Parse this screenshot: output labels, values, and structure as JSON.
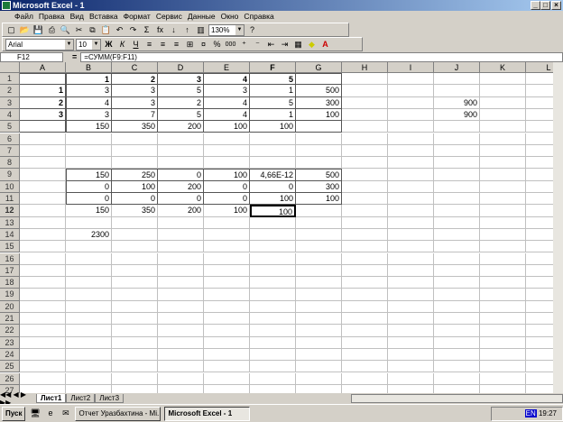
{
  "window": {
    "title": "Microsoft Excel - 1"
  },
  "menu": [
    "Файл",
    "Правка",
    "Вид",
    "Вставка",
    "Формат",
    "Сервис",
    "Данные",
    "Окно",
    "Справка"
  ],
  "toolbar": {
    "zoom": "130%",
    "font": "Arial",
    "size": "10",
    "bold": "Ж",
    "italic": "К",
    "underline": "Ч",
    "sum": "Σ",
    "fx": "fx",
    "percent": "%",
    "thousands": "000"
  },
  "formula_bar": {
    "cell": "F12",
    "eq": "=",
    "formula": "=СУММ(F9:F11)"
  },
  "columns": [
    "A",
    "B",
    "C",
    "D",
    "E",
    "F",
    "G",
    "H",
    "I",
    "J",
    "K",
    "L"
  ],
  "rows": [
    [
      "",
      "1",
      "2",
      "3",
      "4",
      "5",
      "",
      "",
      "",
      "",
      "",
      ""
    ],
    [
      "1",
      "3",
      "3",
      "5",
      "3",
      "1",
      "500",
      "",
      "",
      "",
      "",
      ""
    ],
    [
      "2",
      "4",
      "3",
      "2",
      "4",
      "5",
      "300",
      "",
      "",
      "900",
      "",
      ""
    ],
    [
      "3",
      "3",
      "7",
      "5",
      "4",
      "1",
      "100",
      "",
      "",
      "900",
      "",
      ""
    ],
    [
      "",
      "150",
      "350",
      "200",
      "100",
      "100",
      "",
      "",
      "",
      "",
      "",
      ""
    ],
    [
      "",
      "",
      "",
      "",
      "",
      "",
      "",
      "",
      "",
      "",
      "",
      ""
    ],
    [
      "",
      "",
      "",
      "",
      "",
      "",
      "",
      "",
      "",
      "",
      "",
      ""
    ],
    [
      "",
      "",
      "",
      "",
      "",
      "",
      "",
      "",
      "",
      "",
      "",
      ""
    ],
    [
      "",
      "150",
      "250",
      "0",
      "100",
      "4,66E-12",
      "500",
      "",
      "",
      "",
      "",
      ""
    ],
    [
      "",
      "0",
      "100",
      "200",
      "0",
      "0",
      "300",
      "",
      "",
      "",
      "",
      ""
    ],
    [
      "",
      "0",
      "0",
      "0",
      "0",
      "100",
      "100",
      "",
      "",
      "",
      "",
      ""
    ],
    [
      "",
      "150",
      "350",
      "200",
      "100",
      "100",
      "",
      "",
      "",
      "",
      "",
      ""
    ],
    [
      "",
      "",
      "",
      "",
      "",
      "",
      "",
      "",
      "",
      "",
      "",
      ""
    ],
    [
      "",
      "2300",
      "",
      "",
      "",
      "",
      "",
      "",
      "",
      "",
      "",
      ""
    ]
  ],
  "row_count": 27,
  "selected": "F12",
  "sheets": [
    "Лист1",
    "Лист2",
    "Лист3"
  ],
  "taskbar": {
    "start": "Пуск",
    "items": [
      "Отчет Уразбахтина - Mi...",
      "Microsoft Excel - 1"
    ],
    "lang": "EN",
    "time": "19:27"
  }
}
